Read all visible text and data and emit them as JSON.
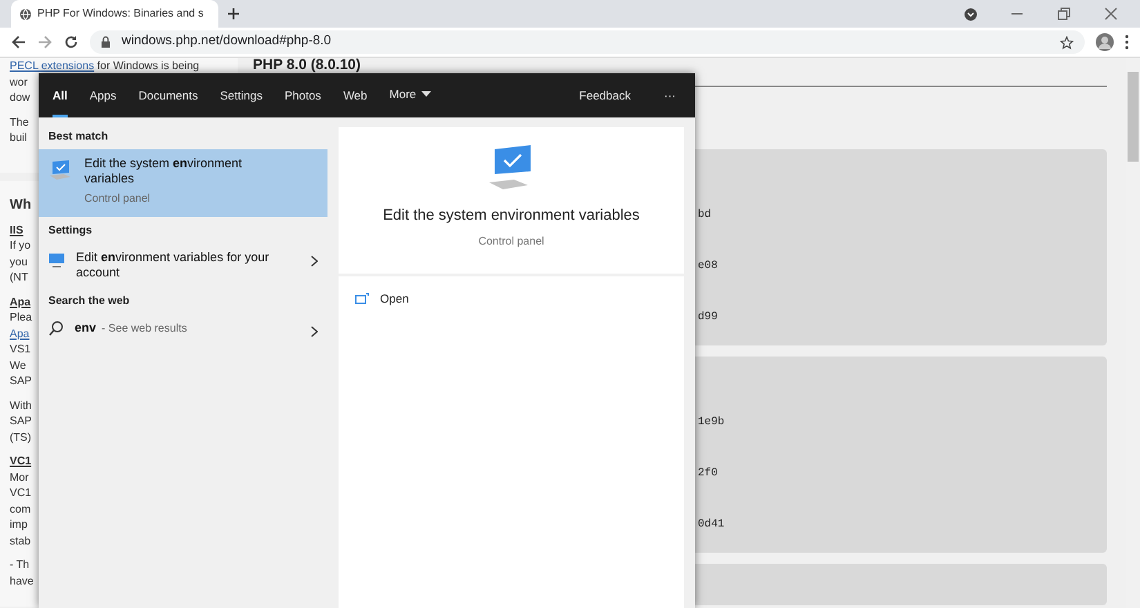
{
  "browser": {
    "tab_title": "PHP For Windows: Binaries and s",
    "url": "windows.php.net/download#php-8.0"
  },
  "page": {
    "intro": {
      "link": "PECL extensions",
      "text": "for Windows is being"
    },
    "left_cards": [
      [
        [
          {
            "kind": "text",
            "text": "wor"
          },
          {
            "kind": "text",
            "text": "dow"
          }
        ],
        [
          {
            "kind": "text",
            "text": "The"
          },
          {
            "kind": "text",
            "text": "buil"
          }
        ]
      ],
      [
        [
          {
            "kind": "heading",
            "text": "Wh"
          }
        ],
        [
          {
            "kind": "subheading",
            "text": "IIS"
          },
          {
            "kind": "text",
            "text": "If yo"
          },
          {
            "kind": "text",
            "text": "you"
          },
          {
            "kind": "text",
            "text": "(NT"
          }
        ],
        [
          {
            "kind": "subheading",
            "text": "Apa"
          },
          {
            "kind": "text",
            "text": "Plea"
          },
          {
            "kind": "link",
            "text": "Apa"
          },
          {
            "kind": "text",
            "text": "VS1"
          },
          {
            "kind": "text",
            "text": "We"
          },
          {
            "kind": "text",
            "text": "SAP"
          }
        ],
        [
          {
            "kind": "text",
            "text": "With"
          },
          {
            "kind": "text",
            "text": "SAP"
          },
          {
            "kind": "text",
            "text": "(TS)"
          }
        ],
        [
          {
            "kind": "subheading",
            "text": "VC1"
          },
          {
            "kind": "text",
            "text": "Mor"
          },
          {
            "kind": "text",
            "text": "VC1"
          },
          {
            "kind": "text",
            "text": "com"
          },
          {
            "kind": "text",
            "text": "imp"
          },
          {
            "kind": "text",
            "text": "stab"
          }
        ],
        [
          {
            "kind": "text",
            "text": "- Th"
          },
          {
            "kind": "text",
            "text": "have"
          }
        ]
      ]
    ],
    "release_heading": "PHP 8.0 (8.0.10)",
    "panels": [
      [
        "bd",
        "e08",
        "d99"
      ],
      [
        "1e9b",
        "2f0",
        "0d41"
      ]
    ]
  },
  "search": {
    "tabs": [
      {
        "label": "All",
        "selected": true,
        "kind": "plain"
      },
      {
        "label": "Apps",
        "selected": false,
        "kind": "plain"
      },
      {
        "label": "Documents",
        "selected": false,
        "kind": "plain"
      },
      {
        "label": "Settings",
        "selected": false,
        "kind": "plain"
      },
      {
        "label": "Photos",
        "selected": false,
        "kind": "plain"
      },
      {
        "label": "Web",
        "selected": false,
        "kind": "plain"
      },
      {
        "label": "More",
        "selected": false,
        "kind": "menu"
      }
    ],
    "feedback": "Feedback",
    "more_options": "···",
    "sections": [
      {
        "heading": "Best match",
        "items": [
          {
            "kind": "app",
            "title": "Edit the system **en**vironment variables",
            "subtitle": "Control panel",
            "selected": true
          }
        ]
      },
      {
        "heading": "Settings",
        "items": [
          {
            "kind": "setting",
            "title": "Edit **en**vironment variables for your account",
            "selected": false
          }
        ]
      },
      {
        "heading": "Search the web",
        "items": [
          {
            "kind": "web",
            "title": "env",
            "subtitle": "- See web results",
            "selected": false
          }
        ]
      }
    ],
    "preview": {
      "title": "Edit the system environment variables",
      "subtitle": "Control panel",
      "actions": [
        "Open"
      ]
    }
  }
}
